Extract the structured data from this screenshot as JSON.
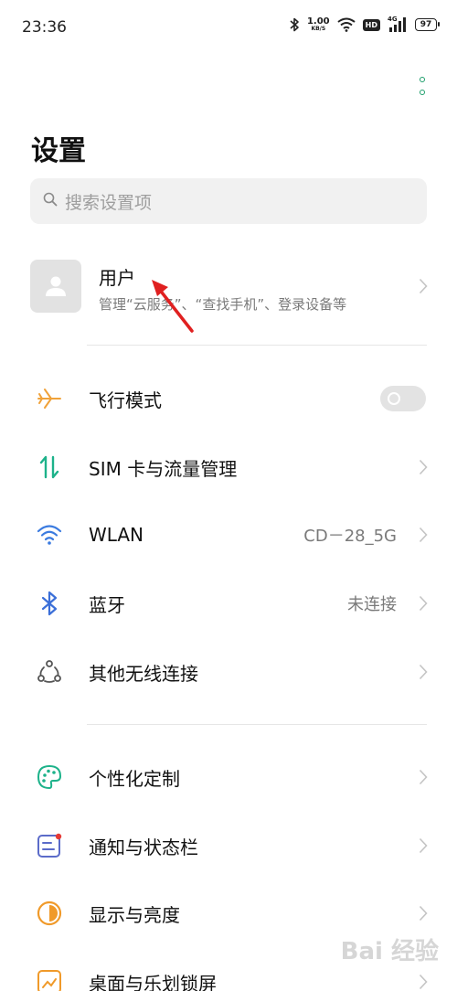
{
  "status_bar": {
    "time": "23:36",
    "net_speed": "1.00",
    "net_unit": "KB/S",
    "hd": "HD",
    "network": "4G",
    "battery": "97"
  },
  "page": {
    "title": "设置",
    "search_placeholder": "搜索设置项"
  },
  "user": {
    "title": "用户",
    "subtitle": "管理“云服务”、“查找手机”、登录设备等"
  },
  "settings": [
    {
      "label": "飞行模式",
      "icon": "airplane-icon",
      "control": "toggle",
      "toggle_on": false
    },
    {
      "label": "SIM 卡与流量管理",
      "icon": "sim-data-icon",
      "control": "chevron"
    },
    {
      "label": "WLAN",
      "icon": "wifi-icon",
      "value": "CD－28_5G",
      "control": "chevron"
    },
    {
      "label": "蓝牙",
      "icon": "bluetooth-icon",
      "value": "未连接",
      "control": "chevron"
    },
    {
      "label": "其他无线连接",
      "icon": "other-wireless-icon",
      "control": "chevron"
    },
    {
      "label": "个性化定制",
      "icon": "palette-icon",
      "control": "chevron"
    },
    {
      "label": "通知与状态栏",
      "icon": "notification-icon",
      "control": "chevron"
    },
    {
      "label": "显示与亮度",
      "icon": "brightness-icon",
      "control": "chevron"
    },
    {
      "label": "桌面与乐划锁屏",
      "icon": "desktop-lock-icon",
      "control": "chevron"
    }
  ],
  "colors": {
    "accent": "#1d9e6b",
    "airplane": "#f0a23a",
    "sim": "#1db28a",
    "wifi": "#3b7be0",
    "bluetooth": "#3b6fd8",
    "palette": "#1db28a",
    "notification": "#5b6bc9",
    "brightness": "#f09a2a",
    "arrow": "#e02020"
  },
  "watermark": "Bai 经验"
}
